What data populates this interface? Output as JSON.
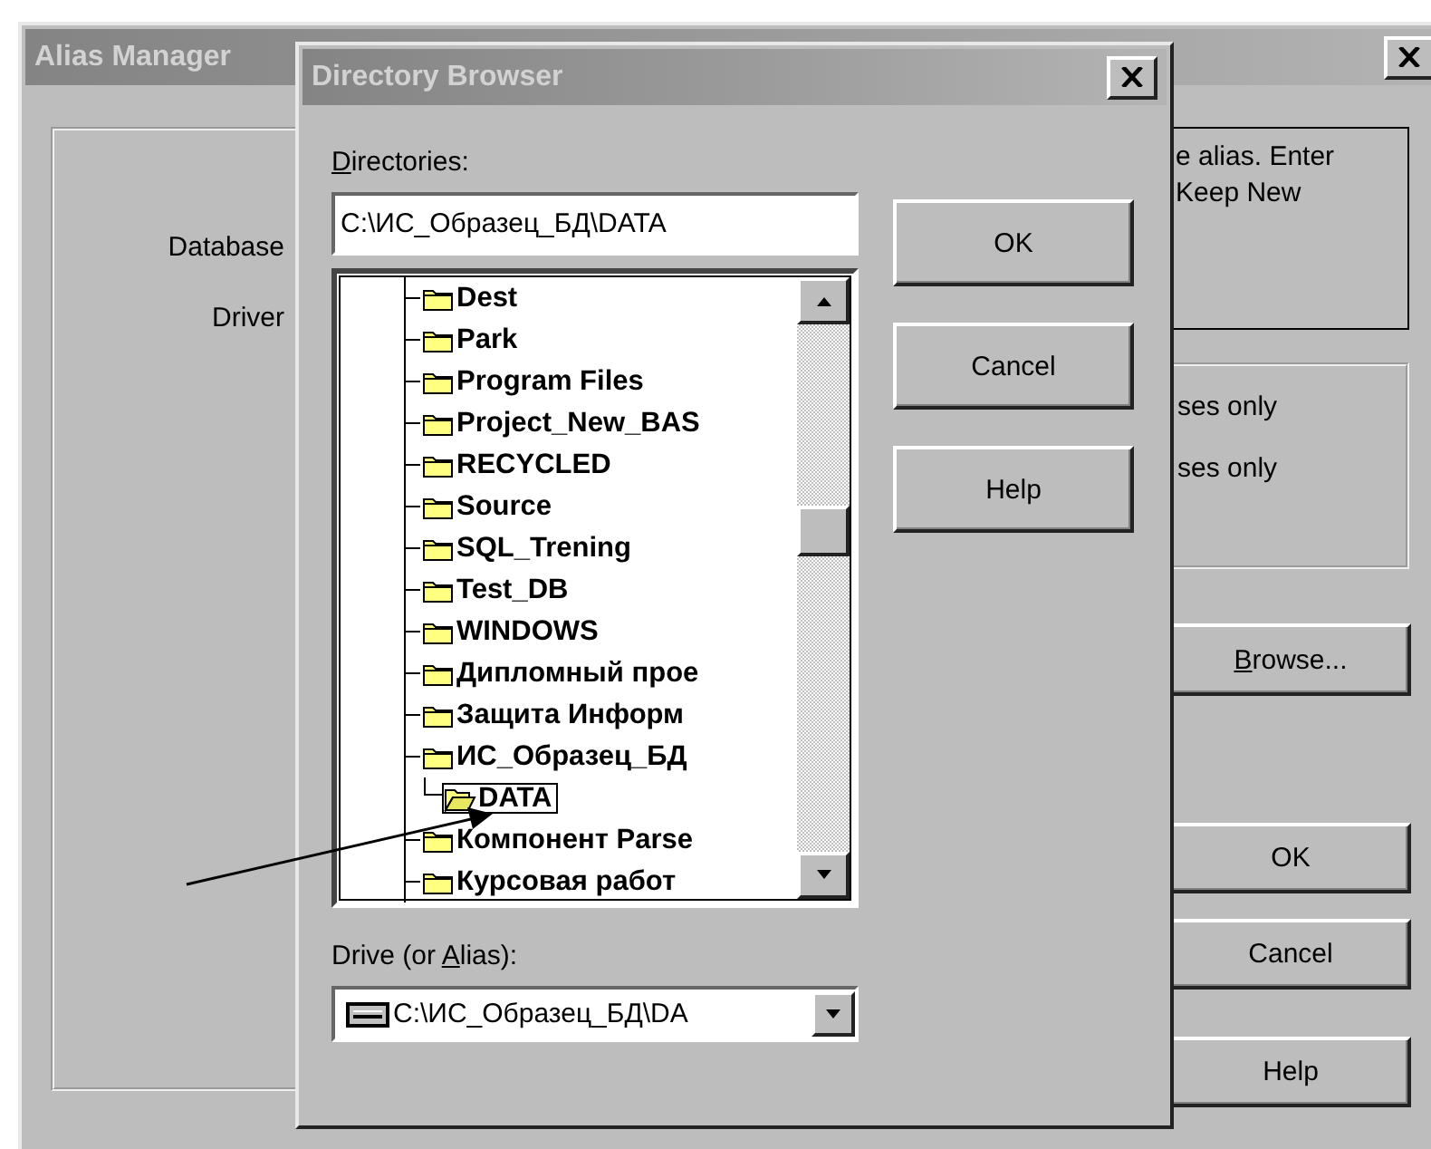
{
  "alias_manager": {
    "title": "Alias Manager",
    "labels": [
      "Database",
      "Driver"
    ],
    "info_lines": [
      "e alias. Enter",
      "Keep New"
    ],
    "options": [
      "ses only",
      "ses only"
    ],
    "browse_button": {
      "accel": "B",
      "rest": "rowse..."
    },
    "buttons": [
      "OK",
      "Cancel",
      "Help"
    ]
  },
  "directory_browser": {
    "title": "Directory Browser",
    "directories_label": {
      "accel": "D",
      "rest": "irectories:"
    },
    "path": "C:\\ИС_Образец_БД\\DATA",
    "tree": [
      {
        "label": "Dest",
        "selected": false
      },
      {
        "label": "Park",
        "selected": false
      },
      {
        "label": "Program Files",
        "selected": false
      },
      {
        "label": "Project_New_BAS",
        "selected": false
      },
      {
        "label": "RECYCLED",
        "selected": false
      },
      {
        "label": "Source",
        "selected": false
      },
      {
        "label": "SQL_Trening",
        "selected": false
      },
      {
        "label": "Test_DB",
        "selected": false
      },
      {
        "label": "WINDOWS",
        "selected": false
      },
      {
        "label": "Дипломный прое",
        "selected": false
      },
      {
        "label": "Защита Информ",
        "selected": false
      },
      {
        "label": "ИС_Образец_БД",
        "selected": false,
        "children": [
          {
            "label": "DATA",
            "selected": true
          }
        ]
      },
      {
        "label": "Компонент Parse",
        "selected": false
      },
      {
        "label": "Курсовая работ",
        "selected": false
      }
    ],
    "drive_label": {
      "before": "Drive (or ",
      "accel": "A",
      "rest": "lias):"
    },
    "drive_value": "C:\\ИС_Образец_БД\\DA",
    "buttons": [
      "OK",
      "Cancel",
      "Help"
    ]
  }
}
